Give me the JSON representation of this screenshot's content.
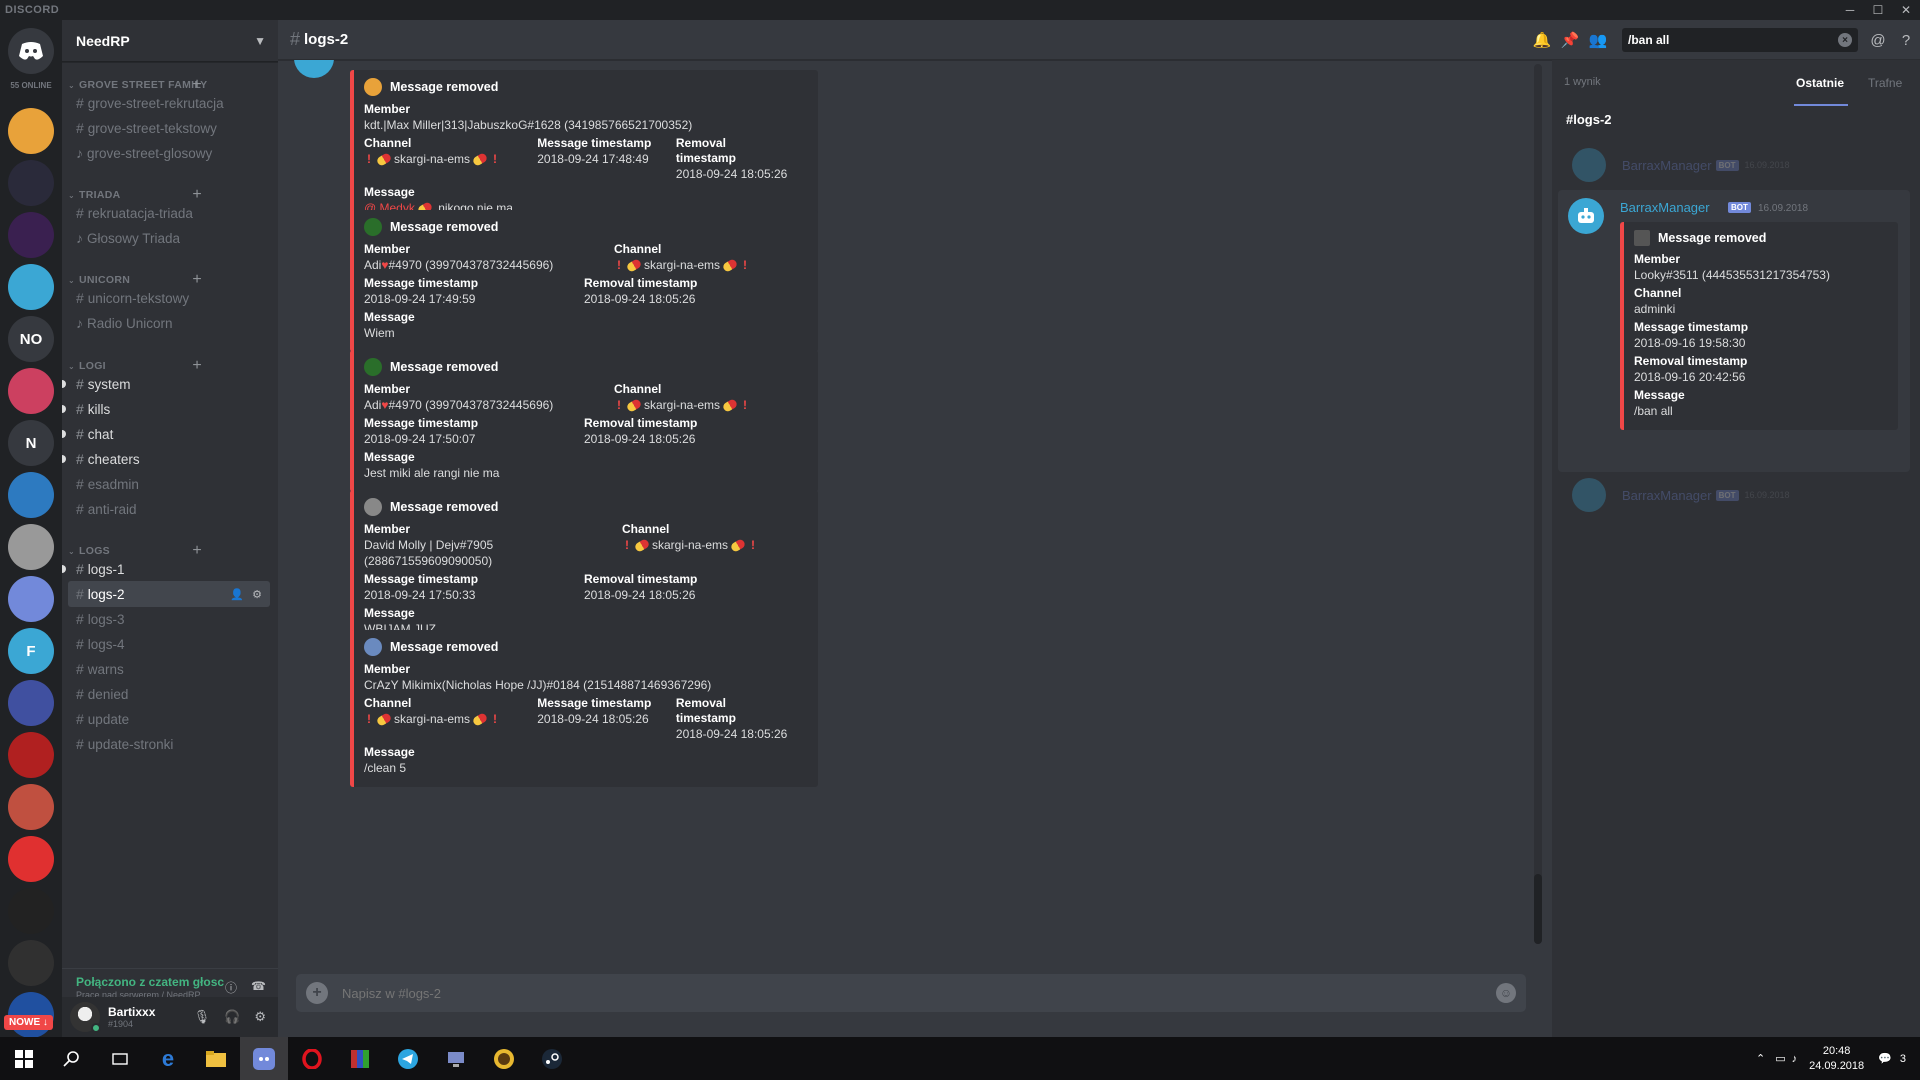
{
  "window": {
    "logo": "DISCORD"
  },
  "guilds": {
    "online_count": "55 ONLINE",
    "nowe_badge": "NOWE ↓",
    "items": [
      {
        "label": "",
        "bg": "#e8a23a"
      },
      {
        "label": "",
        "bg": "#2a2a3a"
      },
      {
        "label": "",
        "bg": "#3a2050"
      },
      {
        "label": "",
        "bg": "#3ba7d4"
      },
      {
        "label": "NO",
        "bg": "#36393f"
      },
      {
        "label": "",
        "bg": "#cc4060"
      },
      {
        "label": "N",
        "bg": "#36393f"
      },
      {
        "label": "",
        "bg": "#2d7ac0"
      },
      {
        "label": "",
        "bg": "#999999"
      },
      {
        "label": "",
        "bg": "#7289da"
      },
      {
        "label": "F",
        "bg": "#3ba7d4"
      },
      {
        "label": "",
        "bg": "#4050a0"
      },
      {
        "label": "",
        "bg": "#b02020"
      },
      {
        "label": "",
        "bg": "#c05040"
      },
      {
        "label": "",
        "bg": "#e03030"
      },
      {
        "label": "",
        "bg": "#222222"
      },
      {
        "label": "",
        "bg": "#303030"
      },
      {
        "label": "",
        "bg": "#2050a0"
      }
    ]
  },
  "server": {
    "name": "NeedRP"
  },
  "sidebar": {
    "categories": [
      {
        "name": "GROVE STREET FAMILY",
        "channels": [
          "grove-street-rekrutacja",
          "grove-street-tekstowy",
          "grove-street-glosowy"
        ]
      },
      {
        "name": "TRIADA",
        "channels": [
          "rekruatacja-triada",
          "Głosowy Triada"
        ]
      },
      {
        "name": "UNICORN",
        "channels": [
          "unicorn-tekstowy",
          "Radio Unicorn"
        ]
      },
      {
        "name": "LOGI",
        "channels": [
          "system",
          "kills",
          "chat",
          "cheaters",
          "esadmin",
          "anti-raid"
        ]
      },
      {
        "name": "LOGS",
        "channels": [
          "logs-1",
          "logs-2",
          "logs-3",
          "logs-4",
          "warns",
          "denied",
          "update",
          "update-stronki"
        ]
      }
    ]
  },
  "voice": {
    "status": "Połączono z czatem głosc",
    "sub": "Prace nad serwerem / NeedRP"
  },
  "user": {
    "name": "Bartixxx",
    "tag": "#1904"
  },
  "chat": {
    "channel": "logs-2",
    "composer_placeholder": "Napisz w #logs-2"
  },
  "search": {
    "value": "/ban all"
  },
  "labels": {
    "removed": "Message removed",
    "member": "Member",
    "channel": "Channel",
    "msg_ts": "Message timestamp",
    "rem_ts": "Removal timestamp",
    "message": "Message"
  },
  "logs": [
    {
      "member": "kdt.|Max Miller|313|JabuszkoG#1628 (341985766521700352)",
      "channel": "skargi-na-ems",
      "msg_ts": "2018-09-24 17:48:49",
      "rem_ts": "2018-09-24 18:05:26",
      "message_mention": "@ Medyk",
      "message": " nikogo nie ma"
    },
    {
      "member_a": "Adi",
      "member_b": "#4970 (399704378732445696)",
      "channel": "skargi-na-ems",
      "msg_ts": "2018-09-24 17:49:59",
      "rem_ts": "2018-09-24 18:05:26",
      "message": "Wiem"
    },
    {
      "member_a": "Adi",
      "member_b": "#4970 (399704378732445696)",
      "channel": "skargi-na-ems",
      "msg_ts": "2018-09-24 17:50:07",
      "rem_ts": "2018-09-24 18:05:26",
      "message": "Jest miki ale rangi nie ma"
    },
    {
      "member": "David Molly | Dejv#7905 (288671559609090050)",
      "channel": "skargi-na-ems",
      "msg_ts": "2018-09-24 17:50:33",
      "rem_ts": "2018-09-24 18:05:26",
      "message": "WBIJAM JUZ"
    },
    {
      "member": "CrAzY Mikimix(Nicholas Hope /JJ)#0184 (215148871469367296)",
      "channel": "skargi-na-ems",
      "msg_ts": "2018-09-24 18:05:26",
      "rem_ts": "2018-09-24 18:05:26",
      "message": "/clean 5"
    }
  ],
  "results": {
    "count": "1 wynik",
    "tab_recent": "Ostatnie",
    "tab_relevant": "Trafne",
    "channel": "#logs-2",
    "author": "BarraxManager",
    "bot": "BOT",
    "timestamp": "16.09.2018",
    "ctx_timestamp": "16.09.2018",
    "member": "Looky#3511 (444535531217354753)",
    "channel_value": "adminki",
    "msg_ts": "2018-09-16 19:58:30",
    "rem_ts": "2018-09-16 20:42:56",
    "message": "/ban all"
  },
  "taskbar": {
    "time": "20:48",
    "date": "24.09.2018",
    "notif": "3"
  },
  "colors": {
    "accent": "#7289da",
    "online": "#43b581",
    "danger": "#f04747",
    "bot": "#3ba7d4"
  }
}
